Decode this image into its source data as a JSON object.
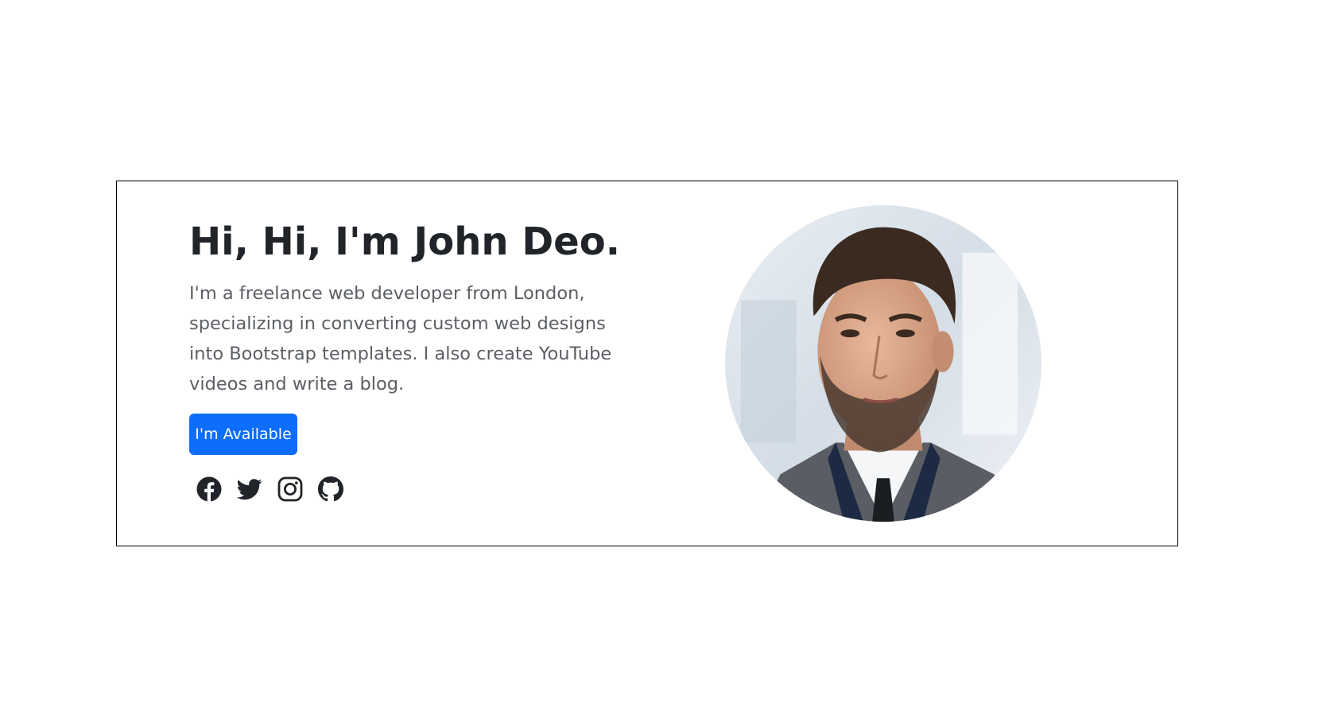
{
  "hero": {
    "title": "Hi, Hi, I'm John Deo.",
    "description": "I'm a freelance web developer from London, specializing in converting custom web designs into Bootstrap templates. I also create YouTube videos and write a blog.",
    "cta_label": "I'm Available",
    "accent_color": "#0d6efd",
    "social_icons": [
      "facebook-icon",
      "twitter-icon",
      "instagram-icon",
      "github-icon"
    ]
  }
}
